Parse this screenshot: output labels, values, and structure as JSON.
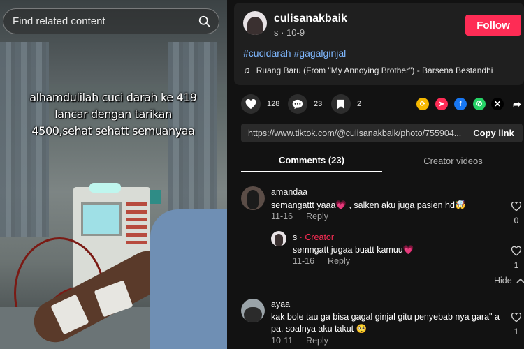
{
  "photo": {
    "search_placeholder": "Find related content",
    "caption": "alhamdulilah cuci darah ke 419\nlancar dengan tarikan\n4500,sehat sehatt semuanyaa"
  },
  "author": {
    "username": "culisanakbaik",
    "meta": "s · 10-9",
    "follow_label": "Follow"
  },
  "post": {
    "hashtags": [
      "#cucidarah",
      "#gagalginjal"
    ],
    "music": "Ruang Baru (From \"My Annoying Brother\") - Barsena Bestandhi"
  },
  "actions": {
    "likes": "128",
    "comments": "23",
    "saves": "2"
  },
  "share_icons": [
    "repost-icon",
    "send-icon",
    "facebook-icon",
    "whatsapp-icon",
    "x-icon",
    "share-icon"
  ],
  "link": {
    "url": "https://www.tiktok.com/@culisanakbaik/photo/755904...",
    "copy_label": "Copy link"
  },
  "tabs": {
    "comments": "Comments (23)",
    "creator": "Creator videos"
  },
  "comments": [
    {
      "name": "amandaa",
      "text": "semangattt yaaa💗 , salken aku juga pasien hd🤯",
      "date": "11-16",
      "reply": "Reply",
      "likes": "0"
    },
    {
      "name": "s",
      "badge": " · Creator",
      "text": "semngatt jugaa buatt kamuu💗",
      "date": "11-16",
      "reply": "Reply",
      "likes": "1"
    },
    {
      "name": "ayaa",
      "text1": "kak bole tau ga bisa gagal ginjal gitu penyebab nya gara\" a",
      "text2": "pa, soalnya aku takut 🥺",
      "date": "10-11",
      "reply": "Reply",
      "likes": "1"
    }
  ],
  "hide_label": "Hide",
  "colors": {
    "follow": "#fe2c55",
    "hashtag": "#7fb8ff",
    "creator": "#fe2c55",
    "bg": "#121212"
  }
}
